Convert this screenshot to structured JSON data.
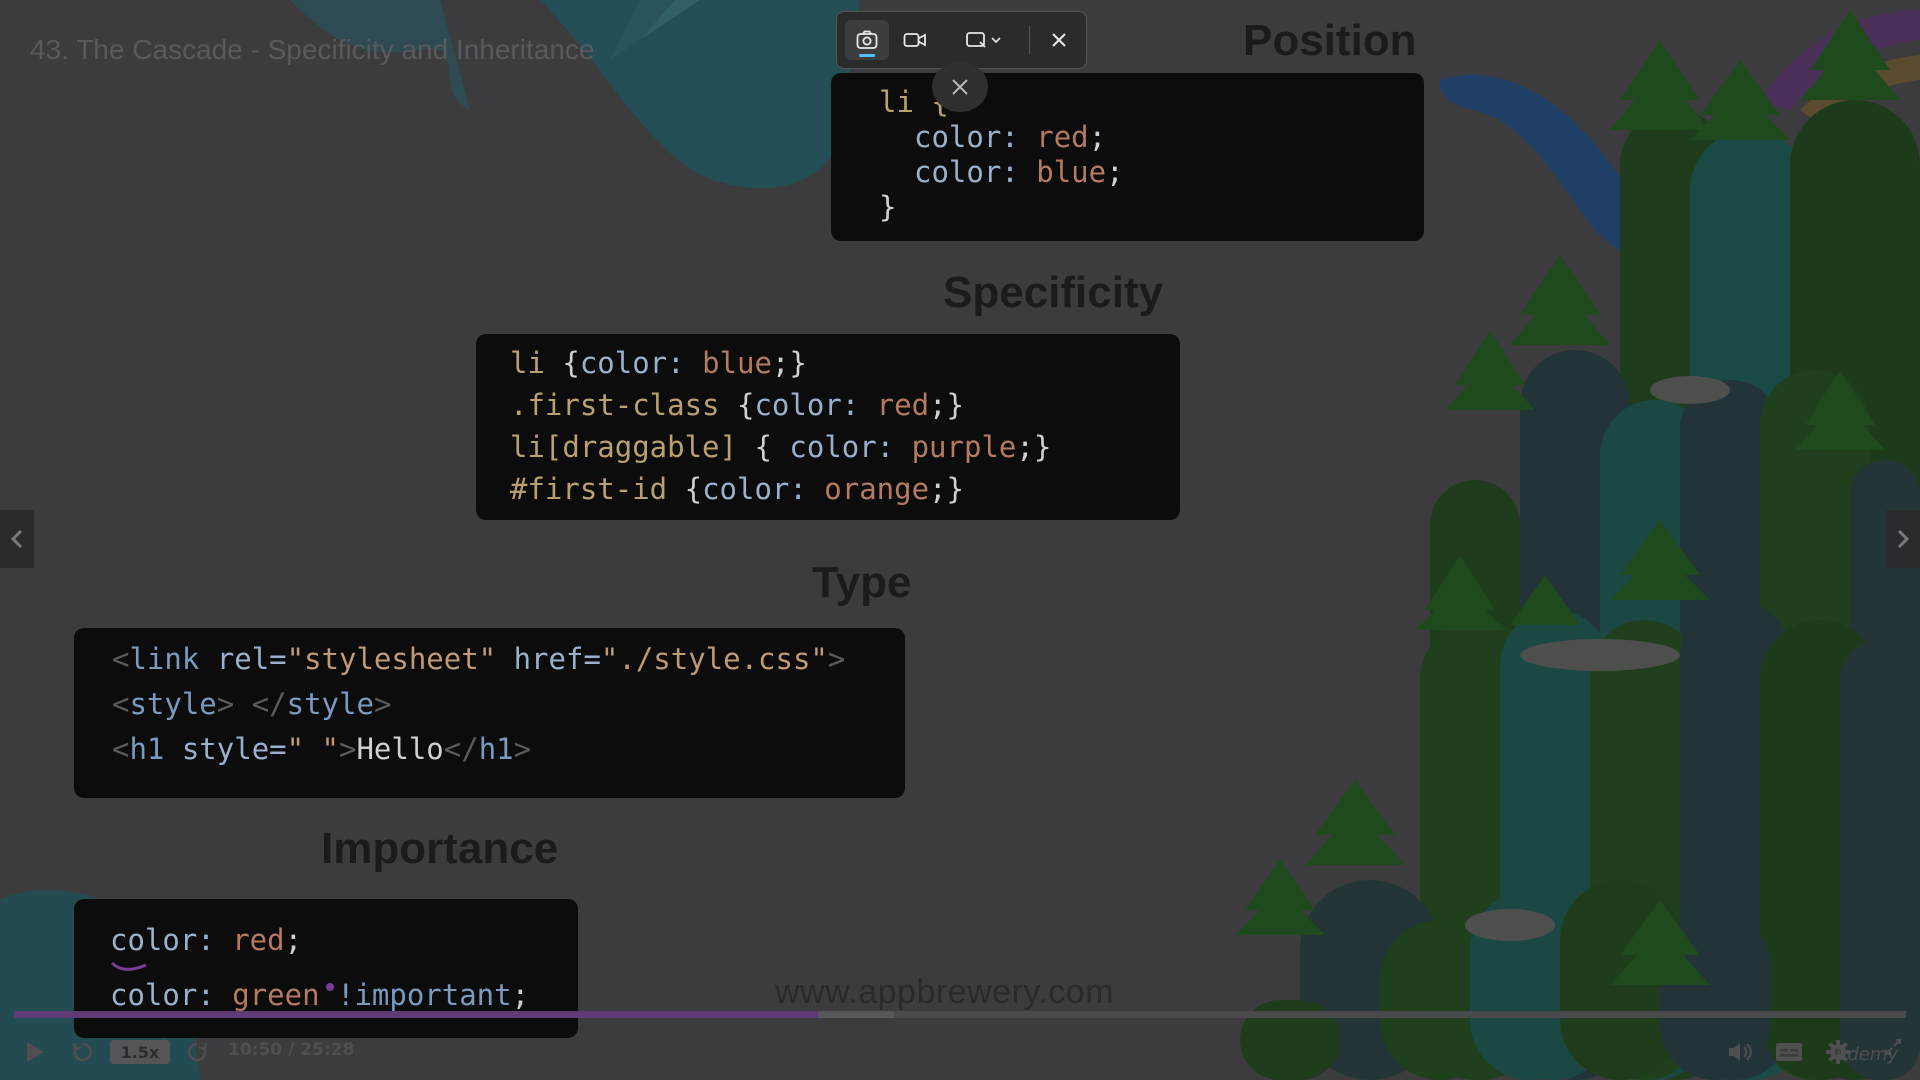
{
  "lesson": {
    "title": "43. The Cascade - Specificity and Inheritance"
  },
  "sections": {
    "position": "Position",
    "specificity": "Specificity",
    "type": "Type",
    "importance": "Importance"
  },
  "code": {
    "position": {
      "line1_sel": "li {",
      "line2_prop": "color:",
      "line2_val": "red",
      "line2_end": ";",
      "line3_prop": "color:",
      "line3_val": "blue",
      "line3_end": ";",
      "line4": "}"
    },
    "specificity": {
      "l1_sel": "li",
      "l1_open": " {",
      "l1_prop": "color:",
      "l1_val": " blue",
      "l1_end": ";}",
      "l2_sel": ".first-class",
      "l2_open": " {",
      "l2_prop": "color:",
      "l2_val": " red",
      "l2_end": ";}",
      "l3_sel": "li[draggable]",
      "l3_open": " { ",
      "l3_prop": "color:",
      "l3_val": " purple",
      "l3_end": ";}",
      "l4_sel": "#first-id",
      "l4_open": " {",
      "l4_prop": "color:",
      "l4_val": " orange",
      "l4_end": ";}"
    },
    "type": {
      "l1_open": "<",
      "l1_tag": "link",
      "l1_attr1": " rel=",
      "l1_val1": "\"stylesheet\"",
      "l1_attr2": " href=",
      "l1_val2": "\"./style.css\"",
      "l1_close": ">",
      "l2_open": "<",
      "l2_tag": "style",
      "l2_mid": "> </",
      "l2_tag2": "style",
      "l2_close": ">",
      "l3_open": "<",
      "l3_tag": "h1",
      "l3_attr": " style=",
      "l3_val": "\" \"",
      "l3_gt": ">",
      "l3_text": "Hello",
      "l3_endopen": "</",
      "l3_tag2": "h1",
      "l3_close": ">"
    },
    "importance": {
      "l1_prop": "color:",
      "l1_val": " red",
      "l1_end": ";",
      "l2_prop": "color:",
      "l2_val": " green",
      "l2_imp": " !important",
      "l2_end": ";"
    }
  },
  "watermark": "www.appbrewery.com",
  "player": {
    "speed": "1.5x",
    "time": "10:50 / 25:28",
    "brand": "udemy",
    "progress": 0.425
  },
  "snip": {
    "icons": [
      "camera-icon",
      "video-icon",
      "rectangle-select-icon",
      "close-icon"
    ]
  },
  "colors": {
    "overlay_bg": "#3c3c3e",
    "code_bg": "#0c0c0c",
    "progress_accent": "#5e3b74",
    "snip_active": "#4cc2ff"
  }
}
